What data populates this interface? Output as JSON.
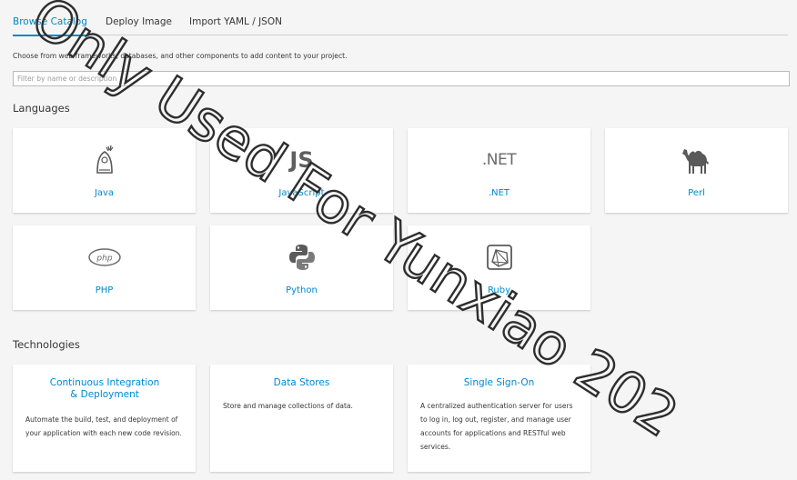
{
  "tabs": [
    {
      "label": "Browse Catalog",
      "active": true
    },
    {
      "label": "Deploy Image",
      "active": false
    },
    {
      "label": "Import YAML / JSON",
      "active": false
    }
  ],
  "intro": "Choose from web frameworks, databases, and other components to add content to your project.",
  "filter": {
    "placeholder": "Filter by name or description",
    "value": ""
  },
  "languages": {
    "title": "Languages",
    "items": [
      {
        "label": "Java",
        "icon": "java-duke-icon"
      },
      {
        "label": "JavaScript",
        "icon": "js-icon",
        "icon_text": "JS"
      },
      {
        "label": ".NET",
        "icon": "dotnet-icon",
        "icon_text": ".NET"
      },
      {
        "label": "Perl",
        "icon": "camel-icon"
      },
      {
        "label": "PHP",
        "icon": "php-icon",
        "icon_text": "php"
      },
      {
        "label": "Python",
        "icon": "python-icon"
      },
      {
        "label": "Ruby",
        "icon": "ruby-gem-icon"
      }
    ]
  },
  "technologies": {
    "title": "Technologies",
    "items": [
      {
        "title": "Continuous Integration & Deployment",
        "desc": "Automate the build, test, and deployment of your application with each new code revision."
      },
      {
        "title": "Data Stores",
        "desc": "Store and manage collections of data."
      },
      {
        "title": "Single Sign-On",
        "desc": "A centralized authentication server for users to log in, log out, register, and manage user accounts for applications and RESTful web services."
      }
    ]
  },
  "watermark": "Only Used For Yunxiao 202",
  "colors": {
    "accent": "#0088ce",
    "text": "#363636",
    "background": "#f5f5f5",
    "card": "#ffffff"
  }
}
